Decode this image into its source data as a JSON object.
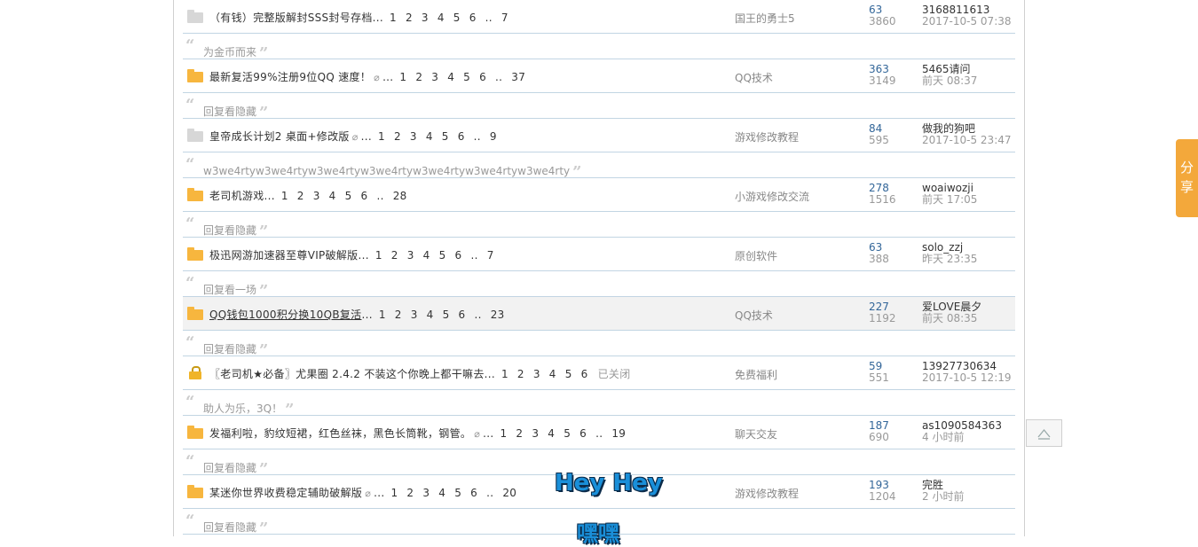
{
  "threads": [
    {
      "icon": "folder-grey-icon",
      "title": "（有钱）完整版解封SSS封号存档",
      "clip": false,
      "pages": [
        "1",
        "2",
        "3",
        "4",
        "5",
        "6",
        "..",
        "7"
      ],
      "forum": "国王的勇士5",
      "replies": "63",
      "views": "3860",
      "last_user": "3168811613",
      "last_time": "2017-10-5 07:38",
      "reply_snippet": "为金币而来"
    },
    {
      "icon": "folder-yellow-icon",
      "title": "最新复活99%注册9位QQ 速度！",
      "clip": true,
      "pages": [
        "1",
        "2",
        "3",
        "4",
        "5",
        "6",
        "..",
        "37"
      ],
      "forum": "QQ技术",
      "replies": "363",
      "views": "3149",
      "last_user": "5465请问",
      "last_time": "前天 08:37",
      "reply_snippet": "回复看隐藏"
    },
    {
      "icon": "folder-grey-icon",
      "title": "皇帝成长计划2 桌面+修改版",
      "clip": true,
      "pages": [
        "1",
        "2",
        "3",
        "4",
        "5",
        "6",
        "..",
        "9"
      ],
      "forum": "游戏修改教程",
      "replies": "84",
      "views": "595",
      "last_user": "做我的狗吧",
      "last_time": "2017-10-5 23:47",
      "reply_snippet": "w3we4rtyw3we4rtyw3we4rtyw3we4rtyw3we4rtyw3we4rtyw3we4rty"
    },
    {
      "icon": "folder-yellow-icon",
      "title": "老司机游戏",
      "clip": false,
      "pages": [
        "1",
        "2",
        "3",
        "4",
        "5",
        "6",
        "..",
        "28"
      ],
      "forum": "小游戏修改交流",
      "replies": "278",
      "views": "1516",
      "last_user": "woaiwozji",
      "last_time": "前天 17:05",
      "reply_snippet": "回复看隐藏"
    },
    {
      "icon": "folder-yellow-icon",
      "title": "极迅网游加速器至尊VIP破解版",
      "clip": false,
      "pages": [
        "1",
        "2",
        "3",
        "4",
        "5",
        "6",
        "..",
        "7"
      ],
      "forum": "原创软件",
      "replies": "63",
      "views": "388",
      "last_user": "solo_zzj",
      "last_time": "昨天 23:35",
      "reply_snippet": "回复看一场"
    },
    {
      "icon": "folder-yellow-icon",
      "title": "QQ钱包1000积分换10QB复活",
      "clip": false,
      "pages": [
        "1",
        "2",
        "3",
        "4",
        "5",
        "6",
        "..",
        "23"
      ],
      "forum": "QQ技术",
      "replies": "227",
      "views": "1192",
      "last_user": "爱LOVE晨夕",
      "last_time": "前天 08:35",
      "reply_snippet": "回复看隐藏"
    },
    {
      "icon": "lock-icon",
      "title": "〖老司机★必备〗尤果圈 2.4.2 不装这个你晚上都干嘛去",
      "clip": false,
      "pages": [
        "1",
        "2",
        "3",
        "4",
        "5",
        "6"
      ],
      "closed": "已关闭",
      "forum": "免费福利",
      "replies": "59",
      "views": "551",
      "last_user": "13927730634",
      "last_time": "2017-10-5 12:19",
      "reply_snippet": "助人为乐，3Q！"
    },
    {
      "icon": "folder-yellow-icon",
      "title": "发福利啦，豹纹短裙，红色丝袜，黑色长筒靴，钢管。",
      "clip": true,
      "pages": [
        "1",
        "2",
        "3",
        "4",
        "5",
        "6",
        "..",
        "19"
      ],
      "forum": "聊天交友",
      "replies": "187",
      "views": "690",
      "last_user": "as1090584363",
      "last_time": "4 小时前",
      "reply_snippet": "回复看隐藏"
    },
    {
      "icon": "folder-yellow-icon",
      "title": "某迷你世界收费稳定辅助破解版",
      "clip": true,
      "pages": [
        "1",
        "2",
        "3",
        "4",
        "5",
        "6",
        "..",
        "20"
      ],
      "forum": "游戏修改教程",
      "replies": "193",
      "views": "1204",
      "last_user": "完胜",
      "last_time": "2 小时前",
      "reply_snippet": "回复看隐藏"
    }
  ],
  "ellipsis": "...",
  "share_label": "分享",
  "overlay": {
    "line1": "Hey Hey",
    "line2": "嘿嘿"
  },
  "colors": {
    "accent": "#f3a83b",
    "link": "#336699",
    "border": "#c2d5e3",
    "folder": "#f7b63e"
  }
}
